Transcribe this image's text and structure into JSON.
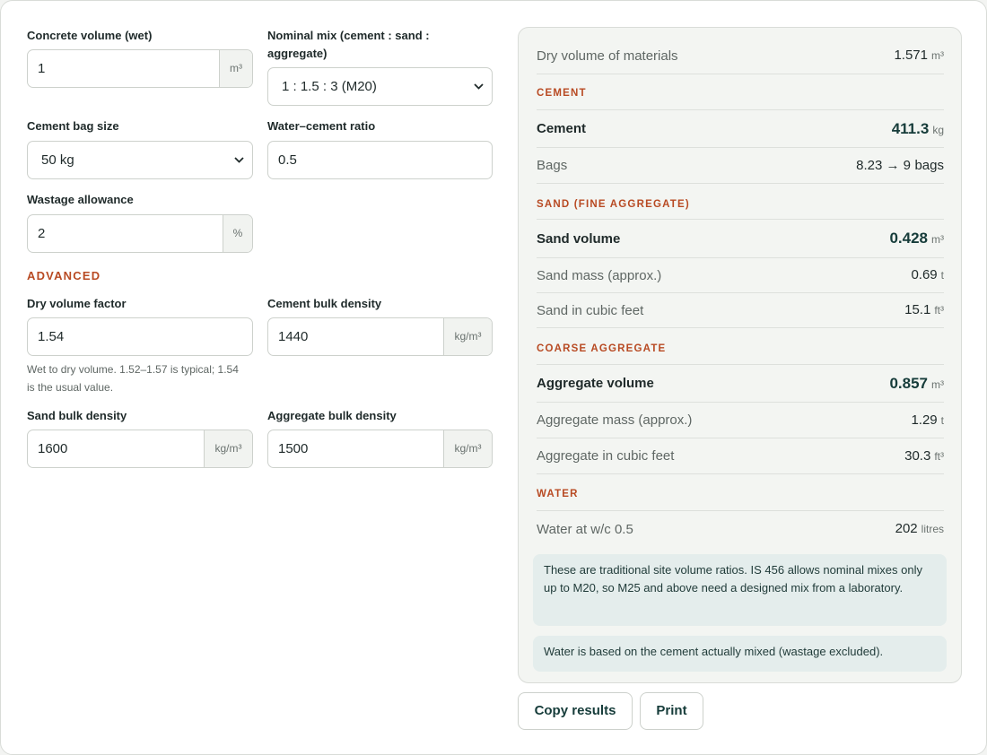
{
  "form": {
    "concrete_volume": {
      "label": "Concrete volume (wet)",
      "value": "1",
      "unit": "m³"
    },
    "nominal_mix": {
      "label_line1": "Nominal mix (cement : sand :",
      "label_line2": "aggregate)",
      "value": "1 : 1.5 : 3 (M20)"
    },
    "cement_bag_size": {
      "label": "Cement bag size",
      "value": "50 kg"
    },
    "water_cement_ratio": {
      "label": "Water–cement ratio",
      "value": "0.5"
    },
    "wastage": {
      "label": "Wastage allowance",
      "value": "2",
      "unit": "%"
    },
    "advanced_heading": "ADVANCED",
    "dry_volume_factor": {
      "label": "Dry volume factor",
      "value": "1.54",
      "hint_line1": "Wet to dry volume. 1.52–1.57 is typical; 1.54",
      "hint_line2": "is the usual value."
    },
    "cement_bulk_density": {
      "label": "Cement bulk density",
      "value": "1440",
      "unit": "kg/m³"
    },
    "sand_bulk_density": {
      "label": "Sand bulk density",
      "value": "1600",
      "unit": "kg/m³"
    },
    "aggregate_bulk_density": {
      "label": "Aggregate bulk density",
      "value": "1500",
      "unit": "kg/m³"
    }
  },
  "results": {
    "dry_volume": {
      "label": "Dry volume of materials",
      "value": "1.571",
      "unit": "m³"
    },
    "cement_heading": "CEMENT",
    "cement": {
      "label": "Cement",
      "value": "411.3",
      "unit": "kg"
    },
    "bags": {
      "label": "Bags",
      "value": "8.23 → 9",
      "unit": "bags"
    },
    "sand_heading": "SAND (FINE AGGREGATE)",
    "sand_volume": {
      "label": "Sand volume",
      "value": "0.428",
      "unit": "m³"
    },
    "sand_mass": {
      "label": "Sand mass (approx.)",
      "value": "0.69",
      "unit": "t"
    },
    "sand_cft": {
      "label": "Sand in cubic feet",
      "value": "15.1",
      "unit": "ft³"
    },
    "aggregate_heading": "COARSE AGGREGATE",
    "aggregate_volume": {
      "label": "Aggregate volume",
      "value": "0.857",
      "unit": "m³"
    },
    "aggregate_mass": {
      "label": "Aggregate mass (approx.)",
      "value": "1.29",
      "unit": "t"
    },
    "aggregate_cft": {
      "label": "Aggregate in cubic feet",
      "value": "30.3",
      "unit": "ft³"
    },
    "water_heading": "WATER",
    "water": {
      "label": "Water at w/c 0.5",
      "value": "202",
      "unit": "litres"
    },
    "note1": "These are traditional site volume ratios. IS 456 allows nominal mixes only up to M20, so M25 and above need a designed mix from a laboratory.",
    "note2": "Water is based on the cement actually mixed (wastage excluded)."
  },
  "actions": {
    "copy": "Copy results",
    "print": "Print"
  },
  "icons": {
    "select_arrow": "chevron-down-icon"
  }
}
